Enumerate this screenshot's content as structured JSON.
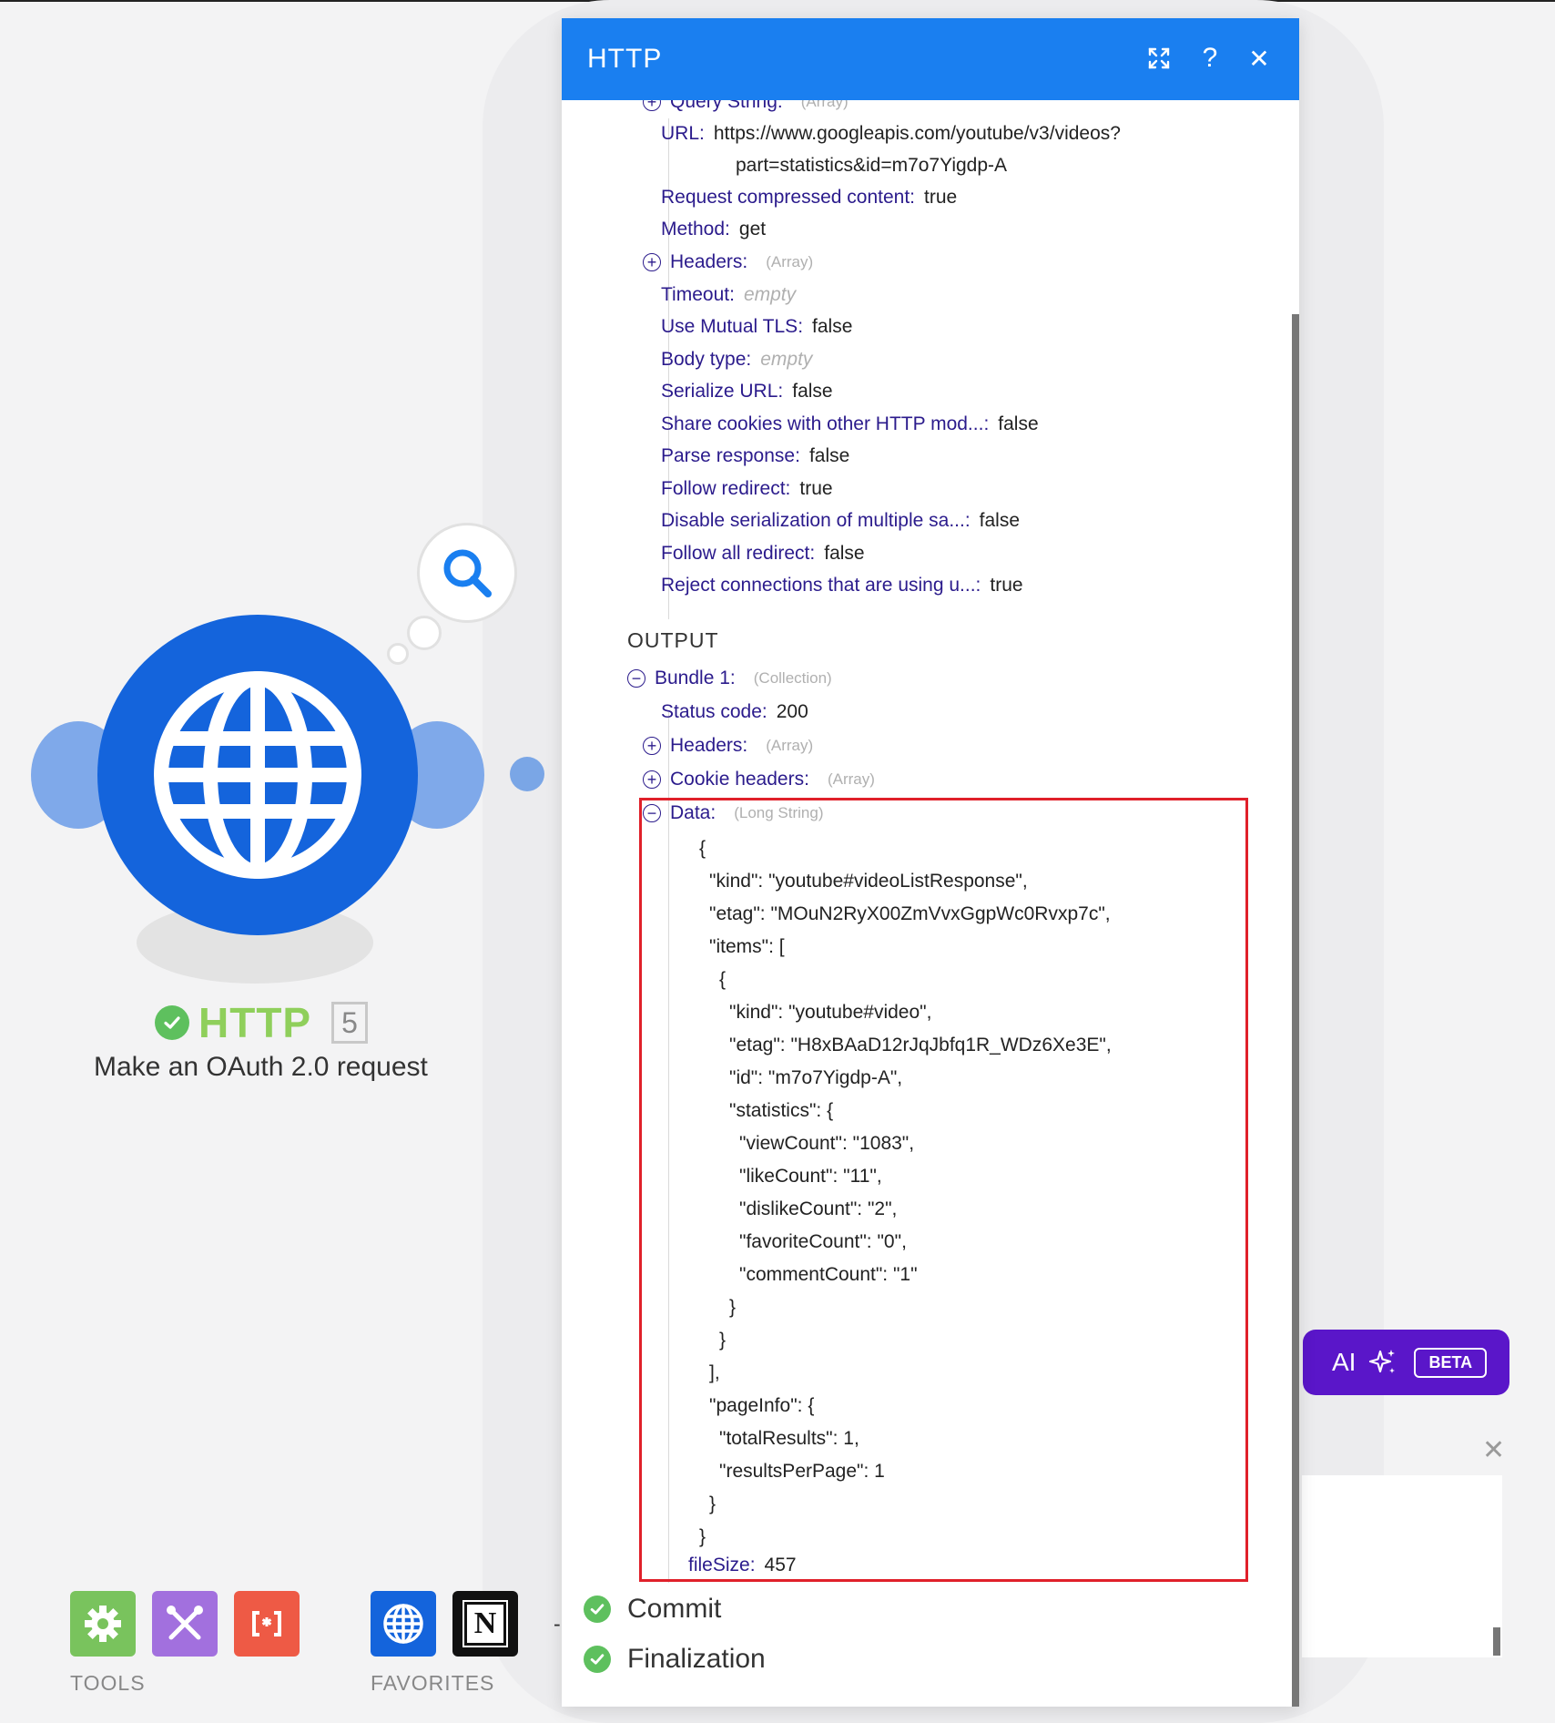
{
  "canvas": {
    "module": {
      "name": "HTTP",
      "badge": "5",
      "subtitle": "Make an OAuth 2.0 request"
    }
  },
  "dock": {
    "tools_label": "TOOLS",
    "favorites_label": "FAVORITES",
    "favorites_extra": "-"
  },
  "ai": {
    "label": "AI",
    "badge": "BETA"
  },
  "dialog": {
    "title": "HTTP",
    "input_rows": [
      {
        "key": "Query String",
        "type": "(Array)",
        "toggle": "+"
      },
      {
        "key": "URL",
        "value": "https://www.googleapis.com/youtube/v3/videos?",
        "value2": "part=statistics&id=m7o7Yigdp-A"
      },
      {
        "key": "Request compressed content",
        "value": "true"
      },
      {
        "key": "Method",
        "value": "get"
      },
      {
        "key": "Headers",
        "type": "(Array)",
        "toggle": "+"
      },
      {
        "key": "Timeout",
        "empty": "empty"
      },
      {
        "key": "Use Mutual TLS",
        "value": "false"
      },
      {
        "key": "Body type",
        "empty": "empty"
      },
      {
        "key": "Serialize URL",
        "value": "false"
      },
      {
        "key": "Share cookies with other HTTP mod...",
        "value": "false"
      },
      {
        "key": "Parse response",
        "value": "false"
      },
      {
        "key": "Follow redirect",
        "value": "true"
      },
      {
        "key": "Disable serialization of multiple sa...",
        "value": "false"
      },
      {
        "key": "Follow all redirect",
        "value": "false"
      },
      {
        "key": "Reject connections that are using u...",
        "value": "true"
      }
    ],
    "output_label": "OUTPUT",
    "bundle": {
      "key": "Bundle 1",
      "type": "(Collection)",
      "toggle": "−"
    },
    "output_rows": [
      {
        "key": "Status code",
        "value": "200"
      },
      {
        "key": "Headers",
        "type": "(Array)",
        "toggle": "+"
      },
      {
        "key": "Cookie headers",
        "type": "(Array)",
        "toggle": "+"
      },
      {
        "key": "Data",
        "type": "(Long String)",
        "toggle": "−"
      }
    ],
    "data_json": [
      "{",
      " \"kind\": \"youtube#videoListResponse\",",
      " \"etag\": \"MOuN2RyX00ZmVvxGgpWc0Rvxp7c\",",
      " \"items\": [",
      "  {",
      "   \"kind\": \"youtube#video\",",
      "   \"etag\": \"H8xBAaD12rJqJbfq1R_WDz6Xe3E\",",
      "   \"id\": \"m7o7Yigdp-A\",",
      "   \"statistics\": {",
      "    \"viewCount\": \"1083\",",
      "    \"likeCount\": \"11\",",
      "    \"dislikeCount\": \"2\",",
      "    \"favoriteCount\": \"0\",",
      "    \"commentCount\": \"1\"",
      "   }",
      "  }",
      " ],",
      " \"pageInfo\": {",
      "  \"totalResults\": 1,",
      "  \"resultsPerPage\": 1",
      " }",
      "}"
    ],
    "file_size": {
      "key": "fileSize",
      "value": "457"
    },
    "statuses": [
      "Commit",
      "Finalization"
    ]
  },
  "colors": {
    "header": "#1a7ff0",
    "module": "#1464dc",
    "key_text": "#2b1b8c",
    "highlight": "#e0202a",
    "ai_button": "#5a16c9",
    "success": "#5ec05e"
  }
}
